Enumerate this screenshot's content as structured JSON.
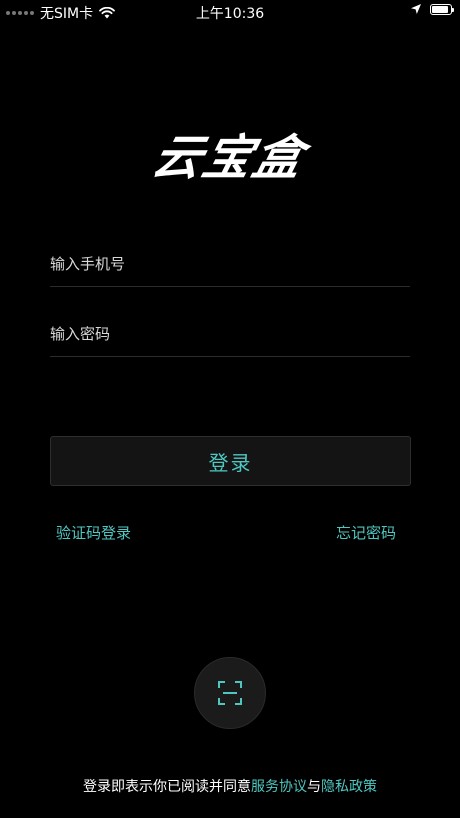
{
  "status_bar": {
    "carrier": "无SIM卡",
    "time": "上午10:36",
    "battery_level": 0.9,
    "icons": [
      "signal-dots-icon",
      "wifi-icon",
      "location-arrow-icon",
      "battery-icon"
    ]
  },
  "logo": {
    "text": "云宝盒"
  },
  "form": {
    "phone_placeholder": "输入手机号",
    "password_placeholder": "输入密码",
    "login_label": "登录"
  },
  "links": {
    "sms_login": "验证码登录",
    "forgot_password": "忘记密码"
  },
  "scan": {
    "icon": "scan-frame-icon"
  },
  "agreement": {
    "prefix": "登录即表示你已阅读并同意",
    "terms": "服务协议",
    "conjunction": "与",
    "privacy": "隐私政策"
  },
  "colors": {
    "background": "#000000",
    "accent": "#4fc7c1",
    "button_bg": "#141414",
    "divider": "#2c2c2c"
  }
}
